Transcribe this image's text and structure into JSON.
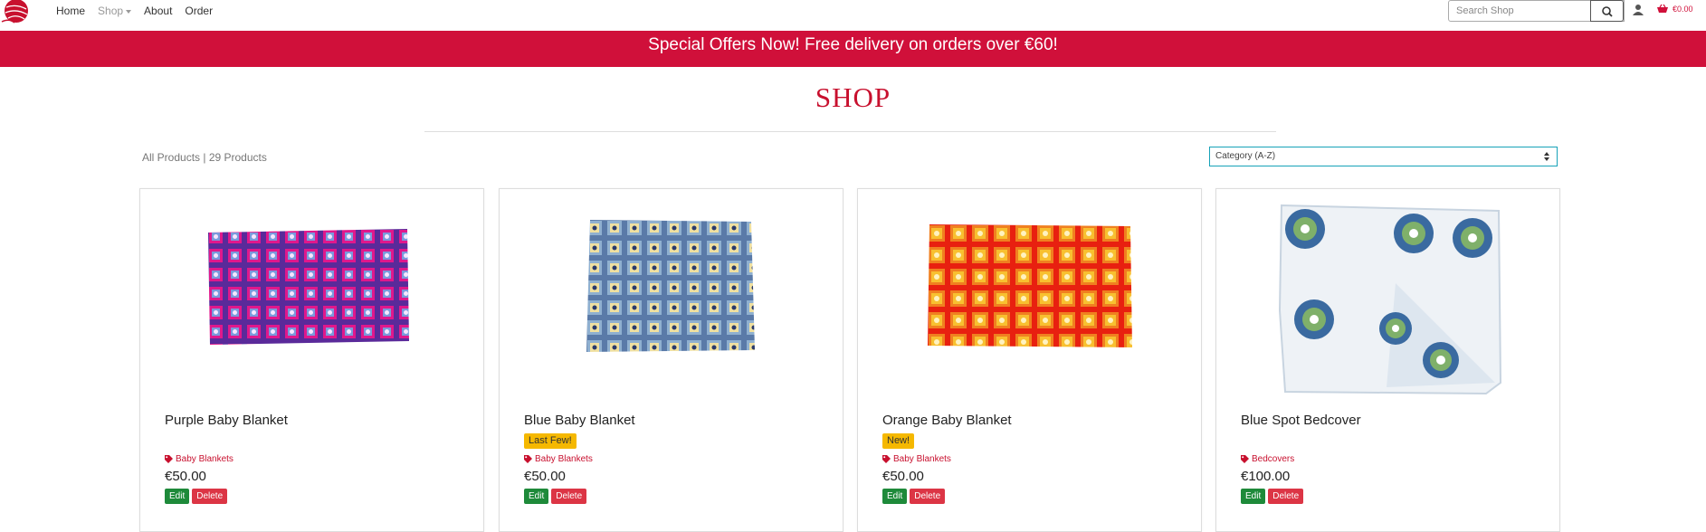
{
  "nav": {
    "home": "Home",
    "shop": "Shop",
    "about": "About",
    "order": "Order",
    "search_placeholder": "Search Shop",
    "cart_total": "€0.00"
  },
  "banner": {
    "text": "Special Offers Now! Free delivery on orders over €60!"
  },
  "page": {
    "title": "SHOP",
    "all_products": "All Products",
    "separator": " | ",
    "count": "29 Products",
    "sort_selected": "Category (A-Z)"
  },
  "products": [
    {
      "name": "Purple Baby Blanket",
      "badge": "",
      "category": "Baby Blankets",
      "price": "€50.00",
      "edit": "Edit",
      "delete": "Delete"
    },
    {
      "name": "Blue Baby Blanket",
      "badge": "Last Few!",
      "category": "Baby Blankets",
      "price": "€50.00",
      "edit": "Edit",
      "delete": "Delete"
    },
    {
      "name": "Orange Baby Blanket",
      "badge": "New!",
      "category": "Baby Blankets",
      "price": "€50.00",
      "edit": "Edit",
      "delete": "Delete"
    },
    {
      "name": "Blue Spot Bedcover",
      "badge": "",
      "category": "Bedcovers",
      "price": "€100.00",
      "edit": "Edit",
      "delete": "Delete"
    }
  ],
  "colors": {
    "brand": "#d0103a",
    "badge": "#f5b800",
    "edit": "#1e8a3a",
    "delete": "#dc3545"
  }
}
